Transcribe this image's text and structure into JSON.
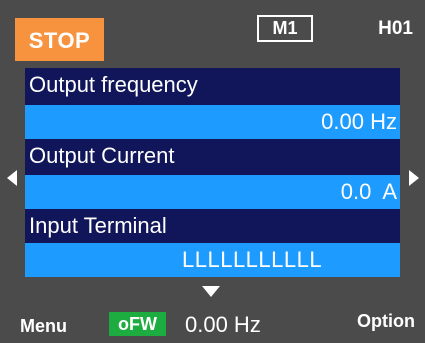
{
  "header": {
    "status": "STOP",
    "mode": "M1",
    "code": "H01"
  },
  "monitor": {
    "items": [
      {
        "label": "Output frequency",
        "value": "0.00 Hz"
      },
      {
        "label": "Output Current",
        "value": "0.0  A"
      },
      {
        "label": "Input Terminal",
        "value": "LLLLLLLLLLL"
      }
    ]
  },
  "footer": {
    "menu_label": "Menu",
    "direction": "oFW",
    "frequency": "0.00 Hz",
    "option_label": "Option"
  },
  "icons": {
    "left": "left-arrow-icon",
    "right": "right-arrow-icon",
    "down": "down-arrow-icon"
  },
  "colors": {
    "stop_badge": "#f7933f",
    "panel": "#11165a",
    "value_bar": "#1e9bff",
    "direction_badge": "#1dac3f",
    "background": "#4b4b4b"
  }
}
